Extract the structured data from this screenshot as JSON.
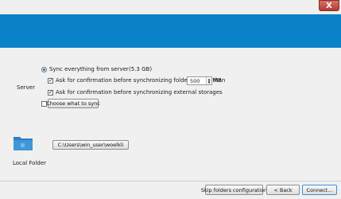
{
  "window": {
    "close_glyph": "X",
    "banner_color": "#0b82c8"
  },
  "server": {
    "label": "Server",
    "sync_all_label": "Sync everything from server",
    "sync_size": "(5.3 GB)",
    "confirm_large_label": "Ask for confirmation before synchronizing folders larger than",
    "large_threshold_value": "500",
    "large_threshold_unit": "MB",
    "confirm_external_label": "Ask for confirmation before synchronizing external storages",
    "choose_sync_label": "Choose what to sync"
  },
  "local": {
    "label": "Local Folder",
    "path_button": "C:\\Users\\win_user\\woelkli"
  },
  "footer": {
    "skip_label": "Skip folders configuration",
    "back_label": "< Back",
    "connect_label": "Connect..."
  },
  "icons": {
    "folder": "folder-icon"
  }
}
